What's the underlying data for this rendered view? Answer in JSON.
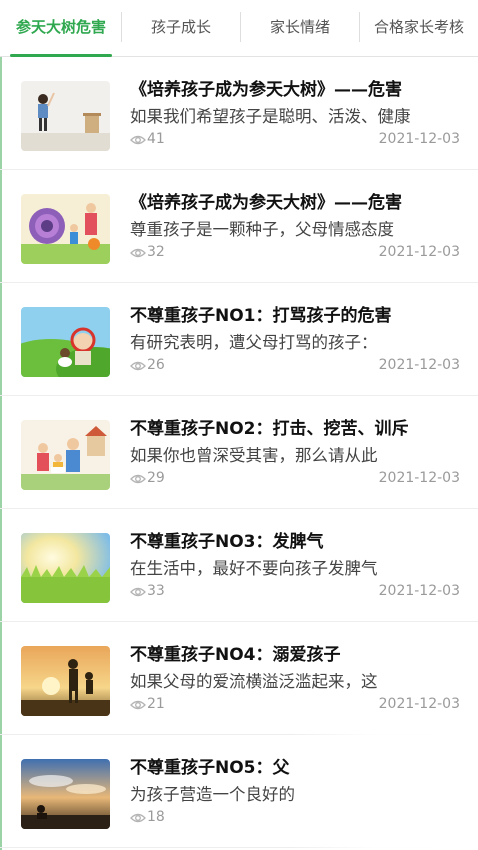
{
  "tabs": [
    {
      "label": "参天大树危害",
      "active": true
    },
    {
      "label": "孩子成长",
      "active": false
    },
    {
      "label": "家长情绪",
      "active": false
    },
    {
      "label": "合格家长考核",
      "active": false
    }
  ],
  "accent_color": "#2fa84f",
  "articles": [
    {
      "title": "《培养孩子成为参天大树》——危害",
      "summary": "如果我们希望孩子是聪明、活泼、健康",
      "views": "41",
      "date": "2021-12-03",
      "thumb_icon": "child-at-wall-image"
    },
    {
      "title": "《培养孩子成为参天大树》——危害",
      "summary": "尊重孩子是一颗种子，父母情感态度",
      "views": "32",
      "date": "2021-12-03",
      "thumb_icon": "family-cartoon-image"
    },
    {
      "title": "不尊重孩子NO1：打骂孩子的危害",
      "summary": "有研究表明，遭父母打骂的孩子：",
      "views": "26",
      "date": "2021-12-03",
      "thumb_icon": "cartoon-meadow-image"
    },
    {
      "title": "不尊重孩子NO2：打击、挖苦、训斥",
      "summary": "如果你也曾深受其害，那么请从此",
      "views": "29",
      "date": "2021-12-03",
      "thumb_icon": "family-reading-image"
    },
    {
      "title": "不尊重孩子NO3：发脾气",
      "summary": "在生活中，最好不要向孩子发脾气",
      "views": "33",
      "date": "2021-12-03",
      "thumb_icon": "sunlit-grass-image"
    },
    {
      "title": "不尊重孩子NO4：溺爱孩子",
      "summary": "如果父母的爱流横溢泛滥起来，这",
      "views": "21",
      "date": "2021-12-03",
      "thumb_icon": "sunset-silhouette-image"
    },
    {
      "title": "不尊重孩子NO5：父",
      "summary": "为孩子营造一个良好的",
      "views": "18",
      "date": "",
      "thumb_icon": "sky-sunset-image"
    }
  ]
}
